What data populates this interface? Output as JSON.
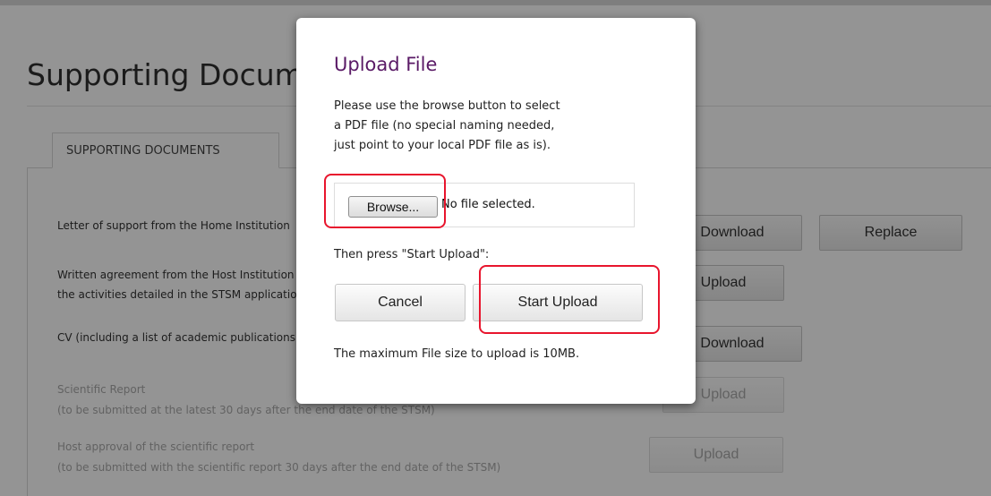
{
  "page": {
    "title": "Supporting Documents",
    "tab_label": "SUPPORTING DOCUMENTS",
    "rows": [
      {
        "line1": "Letter of support from the Home Institution",
        "line2": ""
      },
      {
        "line1": "Written agreement from the Host Institution to accept the applicant for",
        "line2": "the activities detailed in the STSM application"
      },
      {
        "line1": "CV (including a list of academic publications)",
        "line2": ""
      },
      {
        "line1": "Scientific Report",
        "line2": "(to be submitted at the latest 30 days after the end date of the STSM)"
      },
      {
        "line1": "Host approval of the scientific report",
        "line2": "(to be submitted with the scientific report 30 days after the end date of the STSM)"
      }
    ],
    "buttons": {
      "download_1": "Download",
      "replace_1": "Replace",
      "upload_2": "Upload",
      "download_3": "Download",
      "upload_4": "Upload",
      "upload_5": "Upload"
    }
  },
  "modal": {
    "title": "Upload File",
    "instructions": [
      "Please use the browse button to select",
      "a PDF file (no special naming needed,",
      "just point to your local PDF file as is)."
    ],
    "browse_label": "Browse...",
    "file_status": "No file selected.",
    "then_text": "Then press \"Start Upload\":",
    "cancel_label": "Cancel",
    "start_upload_label": "Start Upload",
    "max_size_note": "The maximum File size to upload is 10MB."
  },
  "colors": {
    "highlight": "#e8152d",
    "modal_title": "#5a1a66"
  }
}
